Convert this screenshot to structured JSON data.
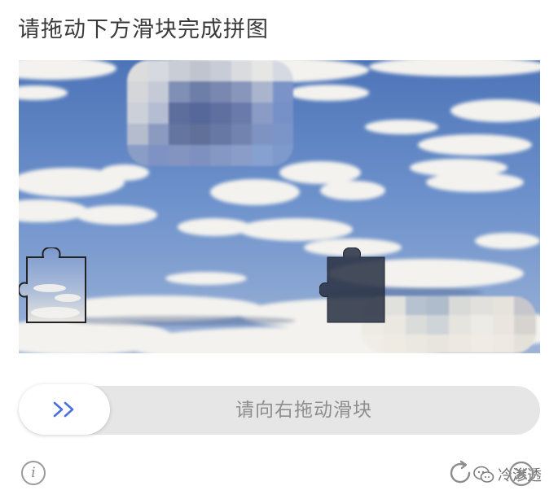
{
  "captcha": {
    "title": "请拖动下方滑块完成拼图",
    "slider_hint": "请向右拖动滑块",
    "handle_arrow": "&gt;&gt;",
    "info_label": "i",
    "watermark_text": "冷渗透"
  },
  "icons": {
    "info": "info-icon",
    "refresh": "refresh-icon",
    "close": "close-icon",
    "arrow": "double-chevron-right-icon",
    "wechat": "wechat-logo"
  },
  "colors": {
    "accent": "#4a6fe0",
    "track": "#e6e6e6",
    "hint_text": "#8e8e8e"
  }
}
